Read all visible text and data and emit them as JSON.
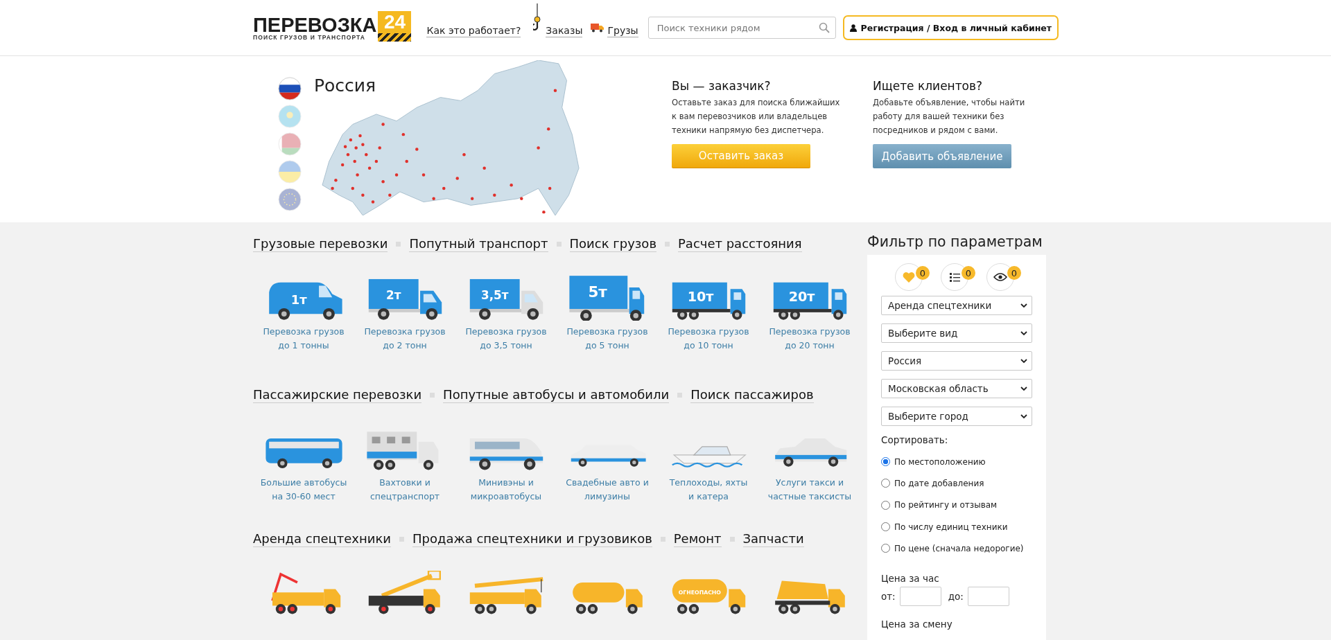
{
  "header": {
    "logo": {
      "word": "ПЕРЕВОЗКА",
      "number": "24",
      "tagline": "ПОИСК ГРУЗОВ И ТРАНСПОРТА"
    },
    "nav": [
      {
        "kind": "text",
        "label": "Как это работает?"
      },
      {
        "kind": "hook",
        "label": "Заказы"
      },
      {
        "kind": "truck",
        "label": "Грузы"
      }
    ],
    "search": {
      "placeholder": "Поиск техники рядом"
    },
    "login_button": "Регистрация / Вход в личный кабинет"
  },
  "hero": {
    "country": "Россия",
    "flags": [
      {
        "kind": "ru",
        "selected": true
      },
      {
        "kind": "kz",
        "selected": false
      },
      {
        "kind": "by",
        "selected": false
      },
      {
        "kind": "ua",
        "selected": false
      },
      {
        "kind": "eu",
        "selected": false
      }
    ],
    "promos": [
      {
        "kind": "order",
        "title": "Вы — заказчик?",
        "text": "Оставьте заказ для поиска ближайших к вам перевозчиков или владельцев техники напрямую без диспетчера.",
        "button": "Оставить заказ"
      },
      {
        "kind": "ad",
        "title": "Ищете клиентов?",
        "text": "Добавьте объявление, чтобы найти работу для вашей техники без посредников и рядом с вами.",
        "button": "Добавить объявление"
      }
    ]
  },
  "sections": [
    {
      "links": [
        "Грузовые перевозки",
        "Попутный транспорт",
        "Поиск грузов",
        "Расчет расстояния"
      ],
      "items": [
        {
          "kind": "van",
          "badge": "1т",
          "label": "Перевозка грузов\nдо 1 тонны"
        },
        {
          "kind": "light",
          "badge": "2т",
          "label": "Перевозка грузов\nдо 2 тонн"
        },
        {
          "kind": "light",
          "badge": "3,5т",
          "label": "Перевозка грузов\nдо 3,5 тонн"
        },
        {
          "kind": "medium",
          "badge": "5т",
          "label": "Перевозка грузов\nдо 5 тонн"
        },
        {
          "kind": "heavy",
          "badge": "10т",
          "label": "Перевозка грузов\nдо 10 тонн"
        },
        {
          "kind": "heavy",
          "badge": "20т",
          "label": "Перевозка грузов\nдо 20 тонн"
        }
      ]
    },
    {
      "links": [
        "Пассажирские перевозки",
        "Попутные автобусы и автомобили",
        "Поиск пассажиров"
      ],
      "items": [
        {
          "kind": "bus",
          "label": "Большие автобусы\nна 30-60 мест"
        },
        {
          "kind": "shift",
          "label": "Вахтовки и\nспецтранспорт"
        },
        {
          "kind": "minibus",
          "label": "Минивэны и\nмикроавтобусы"
        },
        {
          "kind": "limo",
          "label": "Свадебные авто и\nлимузины"
        },
        {
          "kind": "boat",
          "label": "Теплоходы, яхты\nи катера"
        },
        {
          "kind": "car",
          "label": "Услуги такси и\nчастные таксисты"
        }
      ]
    },
    {
      "links": [
        "Аренда спецтехники",
        "Продажа спецтехники и грузовиков",
        "Ремонт",
        "Запчасти"
      ],
      "items": [
        {
          "kind": "pump"
        },
        {
          "kind": "lift"
        },
        {
          "kind": "crane"
        },
        {
          "kind": "vacuum"
        },
        {
          "kind": "tanker",
          "badge": "ОГНЕОПАСНО"
        },
        {
          "kind": "mixer"
        }
      ]
    }
  ],
  "filter": {
    "title": "Фильтр по параметрам",
    "counters": [
      {
        "kind": "heart",
        "count": "0"
      },
      {
        "kind": "list",
        "count": "0"
      },
      {
        "kind": "eye",
        "count": "0"
      }
    ],
    "selects": [
      "Аренда спецтехники",
      "Выберите вид",
      "Россия",
      "Московская область",
      "Выберите город"
    ],
    "sort_label": "Сортировать:",
    "sort_options": [
      {
        "label": "По местоположению",
        "selected": true
      },
      {
        "label": "По дате добавления",
        "selected": false
      },
      {
        "label": "По рейтингу и отзывам",
        "selected": false
      },
      {
        "label": "По числу единиц техники",
        "selected": false
      },
      {
        "label": "По цене (сначала недорогие)",
        "selected": false
      }
    ],
    "price_hour": {
      "label": "Цена за час",
      "from": "от:",
      "to": "до:"
    },
    "price_shift_label": "Цена за смену"
  }
}
